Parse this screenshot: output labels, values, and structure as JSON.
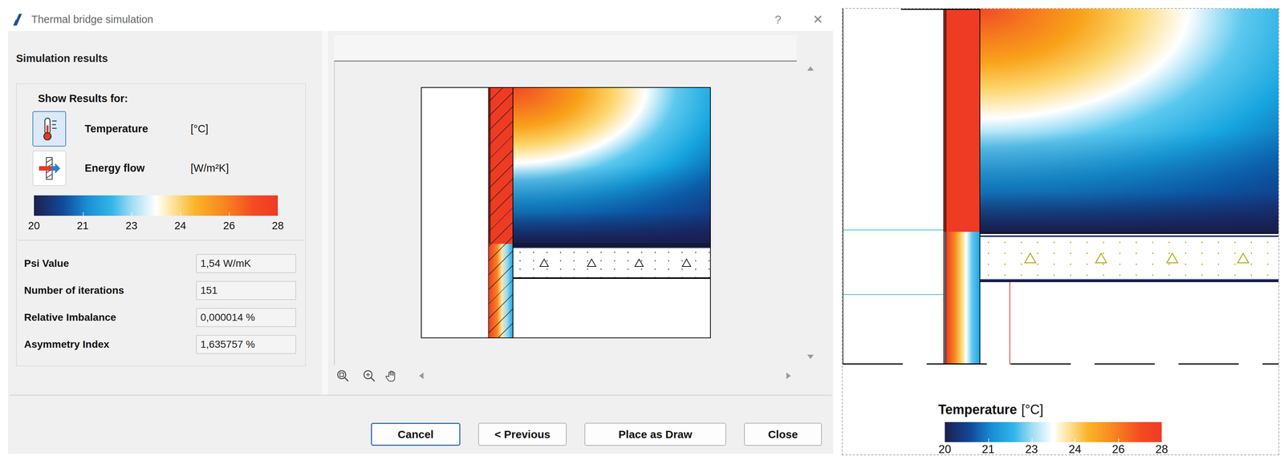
{
  "window": {
    "title": "Thermal bridge simulation",
    "help": "?",
    "close": "✕"
  },
  "panel": {
    "title": "Simulation results",
    "show_results_label": "Show Results for:"
  },
  "result_options": [
    {
      "label": "Temperature",
      "unit": "[°C]",
      "selected": true
    },
    {
      "label": "Energy flow",
      "unit": "[W/m²K]",
      "selected": false
    }
  ],
  "legend": {
    "ticks": [
      "20",
      "21",
      "23",
      "24",
      "26",
      "28"
    ]
  },
  "stats": [
    {
      "label": "Psi Value",
      "value": "1,54 W/mK"
    },
    {
      "label": "Number of iterations",
      "value": "151"
    },
    {
      "label": "Relative Imbalance",
      "value": "0,000014 %"
    },
    {
      "label": "Asymmetry Index",
      "value": "1,635757 %"
    }
  ],
  "buttons": [
    {
      "label": "Cancel",
      "selected": true
    },
    {
      "label": "< Previous",
      "selected": false
    },
    {
      "label": "Place as Draw",
      "selected": false
    },
    {
      "label": "Close",
      "selected": false
    }
  ],
  "export": {
    "legend_title": "Temperature",
    "legend_unit": "[°C]",
    "ticks": [
      "20",
      "21",
      "23",
      "24",
      "26",
      "28"
    ]
  }
}
